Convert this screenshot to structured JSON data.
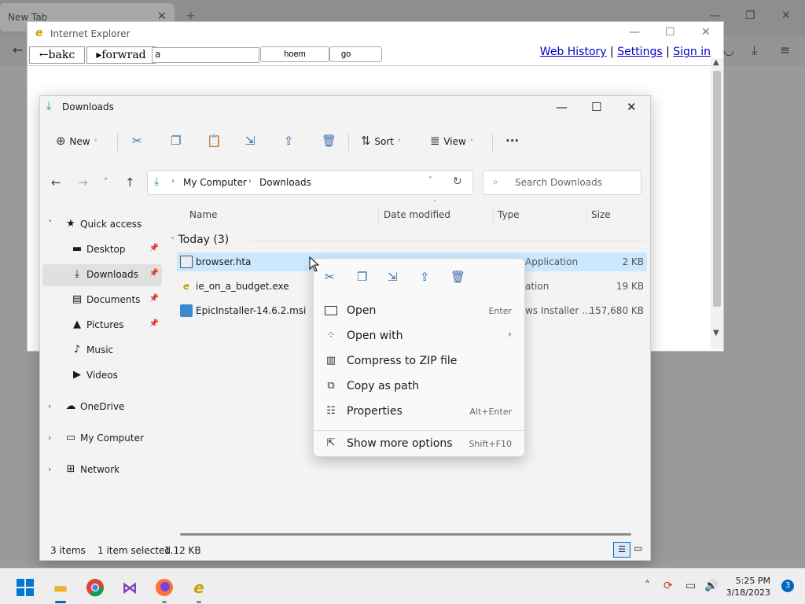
{
  "firefox": {
    "tab_title": "New Tab"
  },
  "ie": {
    "title": "Internet Explorer",
    "logo": "e",
    "back_label": "←bakc",
    "forward_label": "▸forwrad",
    "url_value": "a",
    "home_label": "hoem",
    "go_label": "go",
    "links": {
      "history": "Web History",
      "settings": "Settings",
      "signin": "Sign in",
      "separator": "|"
    }
  },
  "explorer": {
    "title": "Downloads",
    "toolbar": {
      "new_label": "New",
      "sort_label": "Sort",
      "view_label": "View",
      "more_label": "···"
    },
    "breadcrumb": [
      "My Computer",
      "Downloads"
    ],
    "search_placeholder": "Search Downloads",
    "nav": [
      {
        "label": "Quick access",
        "icon": "star-icon",
        "color": "#f2b600"
      },
      {
        "label": "Desktop",
        "icon": "desktop-icon",
        "color": "#2a8fd8"
      },
      {
        "label": "Downloads",
        "icon": "download-icon",
        "color": "#1d9b4a"
      },
      {
        "label": "Documents",
        "icon": "document-icon",
        "color": "#6b6b6b"
      },
      {
        "label": "Pictures",
        "icon": "pictures-icon",
        "color": "#1d74d0"
      },
      {
        "label": "Music",
        "icon": "music-icon",
        "color": "#d4513a"
      },
      {
        "label": "Videos",
        "icon": "videos-icon",
        "color": "#7b3ec0"
      },
      {
        "label": "OneDrive",
        "icon": "cloud-icon",
        "color": "#1d74d0"
      },
      {
        "label": "My Computer",
        "icon": "computer-icon",
        "color": "#2a8fd8"
      },
      {
        "label": "Network",
        "icon": "network-icon",
        "color": "#2a8fd8"
      }
    ],
    "columns": {
      "name": "Name",
      "date": "Date modified",
      "type": "Type",
      "size": "Size"
    },
    "group": "Today (3)",
    "files": [
      {
        "name": "browser.hta",
        "type": "Application",
        "size": "2 KB"
      },
      {
        "name": "ie_on_a_budget.exe",
        "type": "ation",
        "size": "19 KB"
      },
      {
        "name": "EpicInstaller-14.6.2.msi",
        "type": "ws Installer ...",
        "size": "157,680 KB"
      }
    ],
    "status": {
      "items": "3 items",
      "selected": "1 item selected",
      "size": "1.12 KB"
    }
  },
  "context_menu": {
    "items": [
      {
        "label": "Open",
        "shortcut": "Enter",
        "icon": "app-window-icon"
      },
      {
        "label": "Open with",
        "shortcut": "",
        "icon": "open-with-icon"
      },
      {
        "label": "Compress to ZIP file",
        "shortcut": "",
        "icon": "zip-icon"
      },
      {
        "label": "Copy as path",
        "shortcut": "",
        "icon": "copy-path-icon"
      },
      {
        "label": "Properties",
        "shortcut": "Alt+Enter",
        "icon": "properties-icon"
      },
      {
        "label": "Show more options",
        "shortcut": "Shift+F10",
        "icon": "more-options-icon"
      }
    ]
  },
  "taskbar": {
    "time": "5:25 PM",
    "date": "3/18/2023",
    "notifications": "3"
  },
  "colors": {
    "accent": "#0067c0",
    "selection": "#cce8ff",
    "ie_link": "#0000cc"
  }
}
